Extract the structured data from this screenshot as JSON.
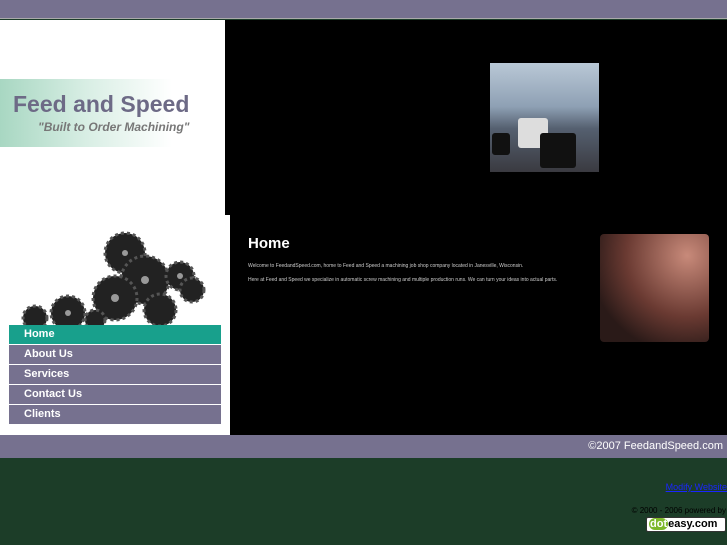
{
  "logo": {
    "title": "Feed and Speed",
    "tagline": "\"Built to Order Machining\""
  },
  "nav": [
    {
      "label": "Home"
    },
    {
      "label": "About Us"
    },
    {
      "label": "Services"
    },
    {
      "label": "Contact Us"
    },
    {
      "label": "Clients"
    }
  ],
  "main": {
    "heading": "Home",
    "p1": "Welcome to FeedandSpeed.com, home to Feed and Speed a machining job shop company located in Janesville, Wisconsin.",
    "p2": "Here at Feed and Speed we specialize in automatic screw machining and multiple production runs. We can turn your ideas into actual parts."
  },
  "footer": {
    "copyright": "©2007 FeedandSpeed.com",
    "modify": "Modify Website",
    "powered": "© 2000 - 2006 powered by",
    "badge_dot": "dot",
    "badge_rest": "easy.com"
  }
}
